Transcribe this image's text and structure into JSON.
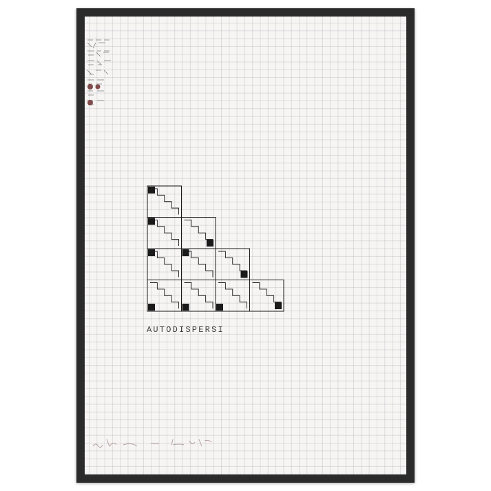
{
  "artwork": {
    "title": "AUTODISPERSI",
    "grid": {
      "rows": 4,
      "max_columns": 4,
      "filled_square_count_by_row": [
        1,
        2,
        3,
        4
      ],
      "stair_steps_per_cell": 4
    },
    "colors": {
      "frame": "#2b2b2b",
      "paper": "#f7f5f4",
      "ink": "#1a1a1a",
      "accent": "#7a3030"
    },
    "signature": true
  }
}
